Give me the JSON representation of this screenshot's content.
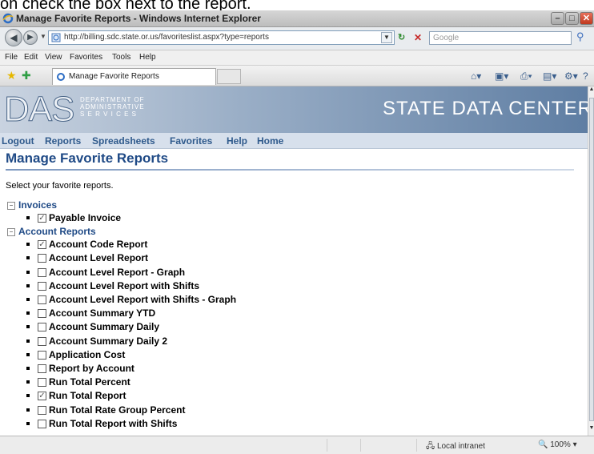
{
  "doc_caption": "on check the box next to the report.",
  "window": {
    "title": "Manage Favorite Reports - Windows Internet Explorer",
    "min": "–",
    "max": "□",
    "close": "✕"
  },
  "address": {
    "url": "http://billing.sdc.state.or.us/favoriteslist.aspx?type=reports",
    "search_placeholder": "Google"
  },
  "menu": [
    "File",
    "Edit",
    "View",
    "Favorites",
    "Tools",
    "Help"
  ],
  "tab": {
    "label": "Manage Favorite Reports"
  },
  "banner": {
    "logo": "DAS",
    "dept_lines": [
      "DEPARTMENT OF",
      "ADMINISTRATIVE",
      "S E R V I C E S"
    ],
    "heading": "STATE DATA CENTER"
  },
  "site_nav": [
    "Logout",
    "Reports",
    "Spreadsheets",
    "Favorites",
    "Help",
    "Home"
  ],
  "page": {
    "title": "Manage Favorite Reports",
    "intro": "Select your favorite reports."
  },
  "groups": [
    {
      "name": "Invoices",
      "items": [
        {
          "label": "Payable Invoice",
          "checked": true
        }
      ]
    },
    {
      "name": "Account Reports",
      "items": [
        {
          "label": "Account Code Report",
          "checked": true
        },
        {
          "label": "Account Level Report",
          "checked": false
        },
        {
          "label": "Account Level Report - Graph",
          "checked": false
        },
        {
          "label": "Account Level Report with Shifts",
          "checked": false
        },
        {
          "label": "Account Level Report with Shifts - Graph",
          "checked": false
        },
        {
          "label": "Account Summary YTD",
          "checked": false
        },
        {
          "label": "Account Summary Daily",
          "checked": false
        },
        {
          "label": "Account Summary Daily 2",
          "checked": false
        },
        {
          "label": "Application Cost",
          "checked": false
        },
        {
          "label": "Report by Account",
          "checked": false
        },
        {
          "label": "Run Total Percent",
          "checked": false
        },
        {
          "label": "Run Total Report",
          "checked": true
        },
        {
          "label": "Run Total Rate Group Percent",
          "checked": false
        },
        {
          "label": "Run Total Report with Shifts",
          "checked": false
        }
      ]
    }
  ],
  "status": {
    "zone": "Local intranet",
    "zoom": "100%"
  },
  "colors": {
    "brand_blue": "#1f4a86",
    "nav_text": "#2f5a8c"
  }
}
